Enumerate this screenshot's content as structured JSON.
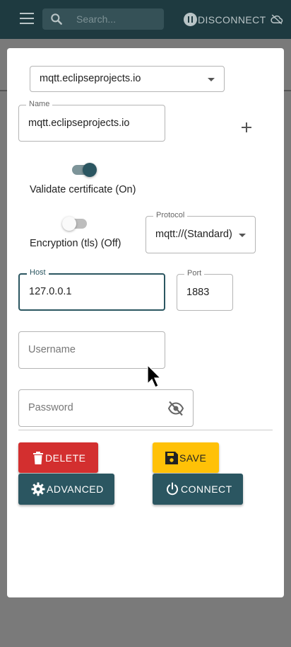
{
  "appbar": {
    "search_placeholder": "Search...",
    "disconnect_label": "DISCONNECT"
  },
  "dialog": {
    "connection_select": {
      "value": "mqtt.eclipseprojects.io"
    },
    "name": {
      "label": "Name",
      "value": "mqtt.eclipseprojects.io"
    },
    "validate_certificate": {
      "label": "Validate certificate (On)",
      "on": true
    },
    "encryption": {
      "label": "Encryption (tls) (Off)",
      "on": false
    },
    "protocol": {
      "label": "Protocol",
      "value": "mqtt://(Standard)"
    },
    "host": {
      "label": "Host",
      "value": "127.0.0.1"
    },
    "port": {
      "label": "Port",
      "value": "1883"
    },
    "username": {
      "placeholder": "Username"
    },
    "password": {
      "placeholder": "Password"
    },
    "buttons": {
      "delete": "DELETE",
      "save": "SAVE",
      "advanced": "ADVANCED",
      "connect": "CONNECT"
    }
  },
  "colors": {
    "primary": "#2b5661",
    "delete": "#d32f2f",
    "save": "#ffc107",
    "appbar": "#1e3a40"
  },
  "icons": [
    "menu-icon",
    "search-icon",
    "pause-icon",
    "cloud-off-icon",
    "plus-icon",
    "visibility-off-icon",
    "delete-icon",
    "save-icon",
    "settings-icon",
    "power-icon",
    "cursor-icon"
  ]
}
